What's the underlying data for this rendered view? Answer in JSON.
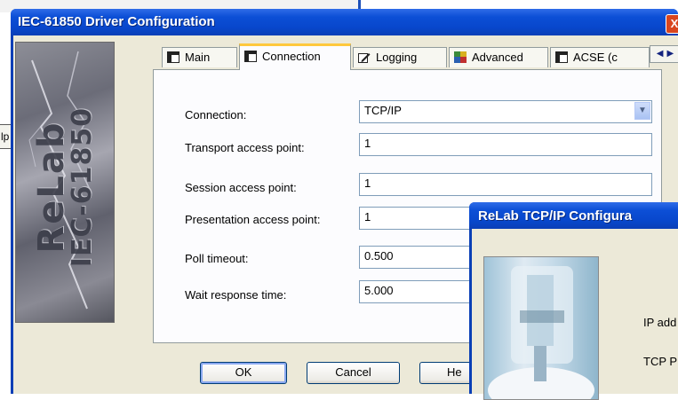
{
  "main_dialog": {
    "title": "IEC-61850 Driver Configuration",
    "close_glyph": "X",
    "logo": {
      "line1": "ReLab",
      "line2": "IEC-61850"
    },
    "tabs": [
      {
        "label": "Main",
        "icon": "window-icon"
      },
      {
        "label": "Connection",
        "icon": "window-icon"
      },
      {
        "label": "Logging",
        "icon": "edit-icon"
      },
      {
        "label": "Advanced",
        "icon": "advanced-icon"
      },
      {
        "label": "ACSE (c",
        "icon": "window-icon"
      }
    ],
    "tab_scroll": {
      "left": "◀",
      "right": "▶"
    },
    "form": {
      "connection_label": "Connection:",
      "connection_value": "TCP/IP",
      "transport_label": "Transport access point:",
      "transport_value": "1",
      "session_label": "Session access point:",
      "session_value": "1",
      "presentation_label": "Presentation access point:",
      "presentation_value": "1",
      "poll_label": "Poll timeout:",
      "poll_value": "0.500",
      "wait_label": "Wait response time:",
      "wait_value": "5.000"
    },
    "buttons": {
      "ok": "OK",
      "cancel": "Cancel",
      "help": "He"
    }
  },
  "background": {
    "help_button_text": "lp"
  },
  "tcp_dialog": {
    "title": "ReLab TCP/IP Configura",
    "ip_label": "IP add",
    "port_label": "TCP P"
  },
  "colors": {
    "titlebar": "#0a3fb6",
    "dialog_face": "#ece9d8",
    "active_tab_accent": "#ffc83c",
    "input_border": "#7f9db9"
  }
}
